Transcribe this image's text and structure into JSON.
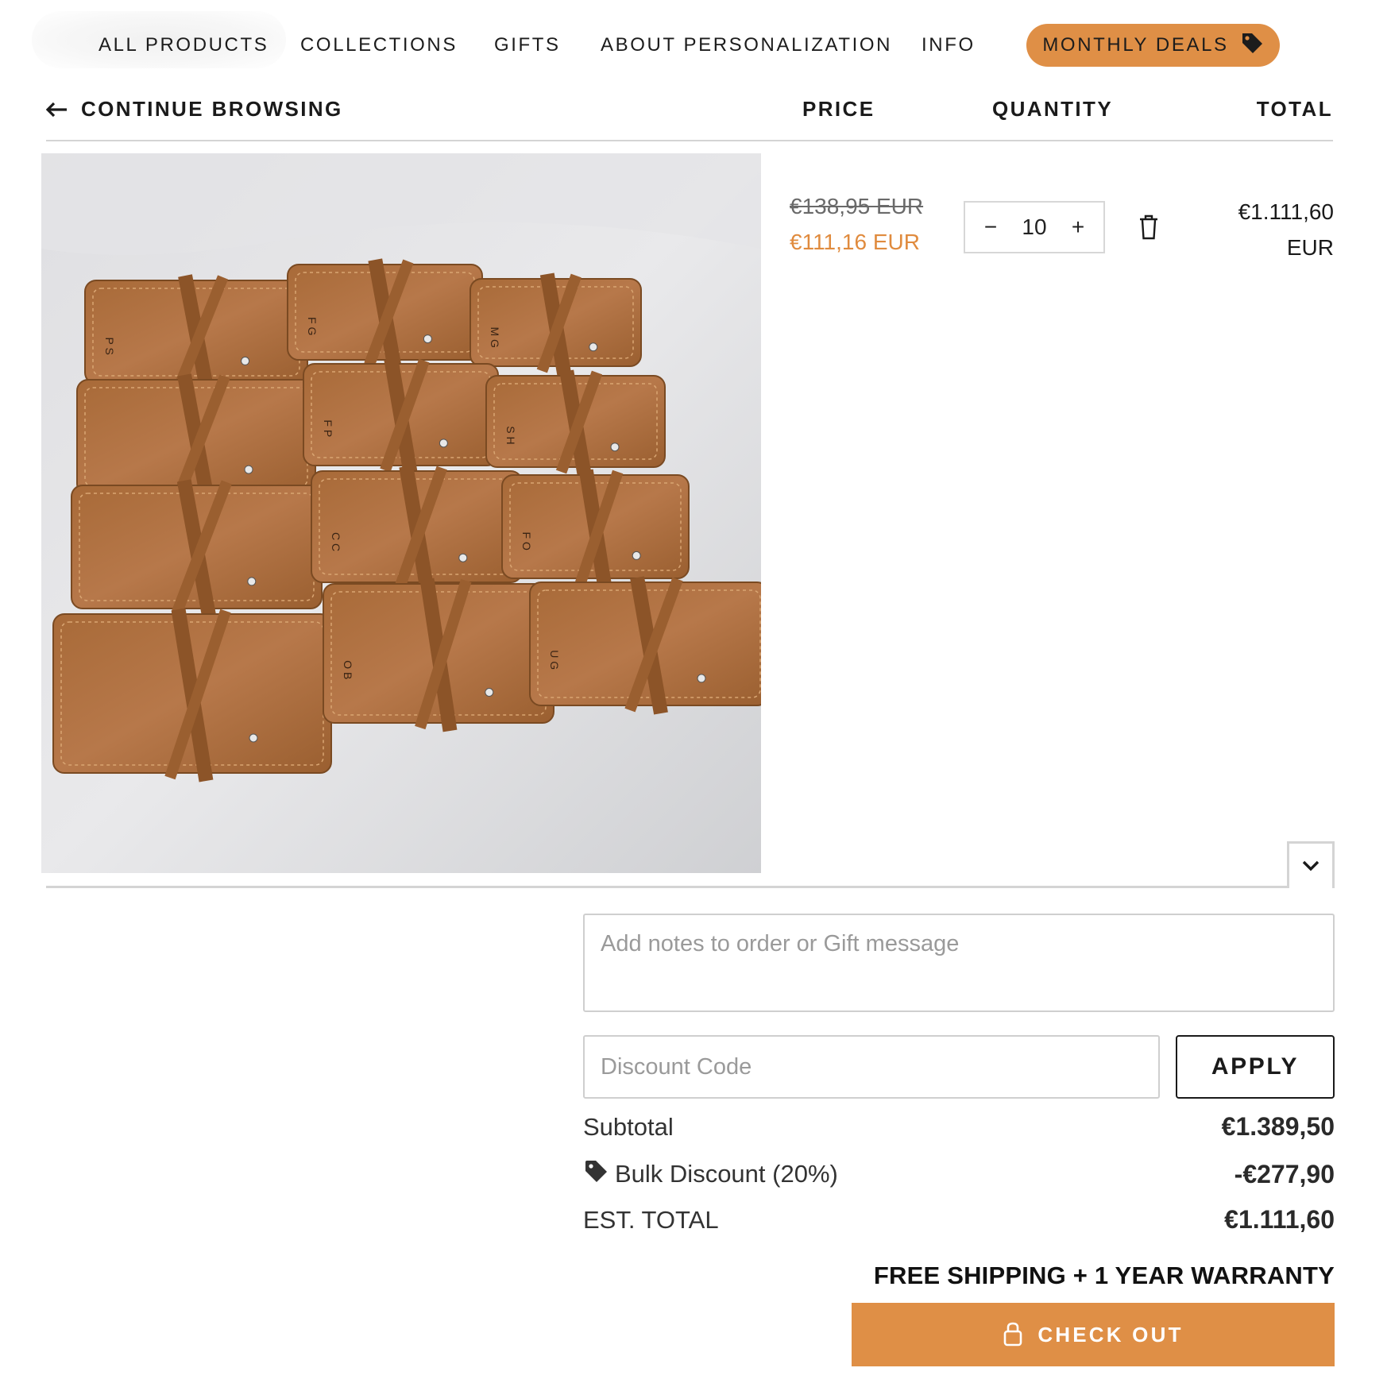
{
  "nav": {
    "items": [
      "ALL PRODUCTS",
      "COLLECTIONS",
      "GIFTS",
      "ABOUT PERSONALIZATION",
      "INFO"
    ],
    "deals_label": "MONTHLY DEALS",
    "deals_icon": "price-tag-icon",
    "accent_color": "#df8f46"
  },
  "cart_header": {
    "back_label": "CONTINUE BROWSING",
    "back_icon": "arrow-left-icon",
    "price_label": "PRICE",
    "quantity_label": "QUANTITY",
    "total_label": "TOTAL"
  },
  "line_item": {
    "image": "photo of personalized tan leather roll-up pouches with initials",
    "initials": [
      "P S",
      "F G",
      "M G",
      "F P",
      "S H",
      "C C",
      "F O",
      "O B",
      "U G"
    ],
    "original_price": "€138,95 EUR",
    "sale_price": "€111,16 EUR",
    "sale_color": "#e08b3e",
    "quantity": "10",
    "decrease_symbol": "−",
    "increase_symbol": "+",
    "delete_icon": "trash-icon",
    "total_amount": "€1.111,60",
    "total_currency": "EUR"
  },
  "collapse_icon": "chevron-down-icon",
  "notes": {
    "placeholder": "Add notes to order or Gift message"
  },
  "discount": {
    "placeholder": "Discount Code",
    "apply_label": "APPLY"
  },
  "summary": {
    "subtotal_label": "Subtotal",
    "subtotal_value": "€1.389,50",
    "discount_icon": "discount-tag-icon",
    "discount_label": "Bulk Discount (20%)",
    "discount_value": "-€277,90",
    "total_label": "EST. TOTAL",
    "total_value": "€1.111,60"
  },
  "shipping_note": "FREE SHIPPING + 1 YEAR WARRANTY",
  "checkout": {
    "label": "CHECK OUT",
    "icon": "lock-icon",
    "color": "#df8f46"
  }
}
